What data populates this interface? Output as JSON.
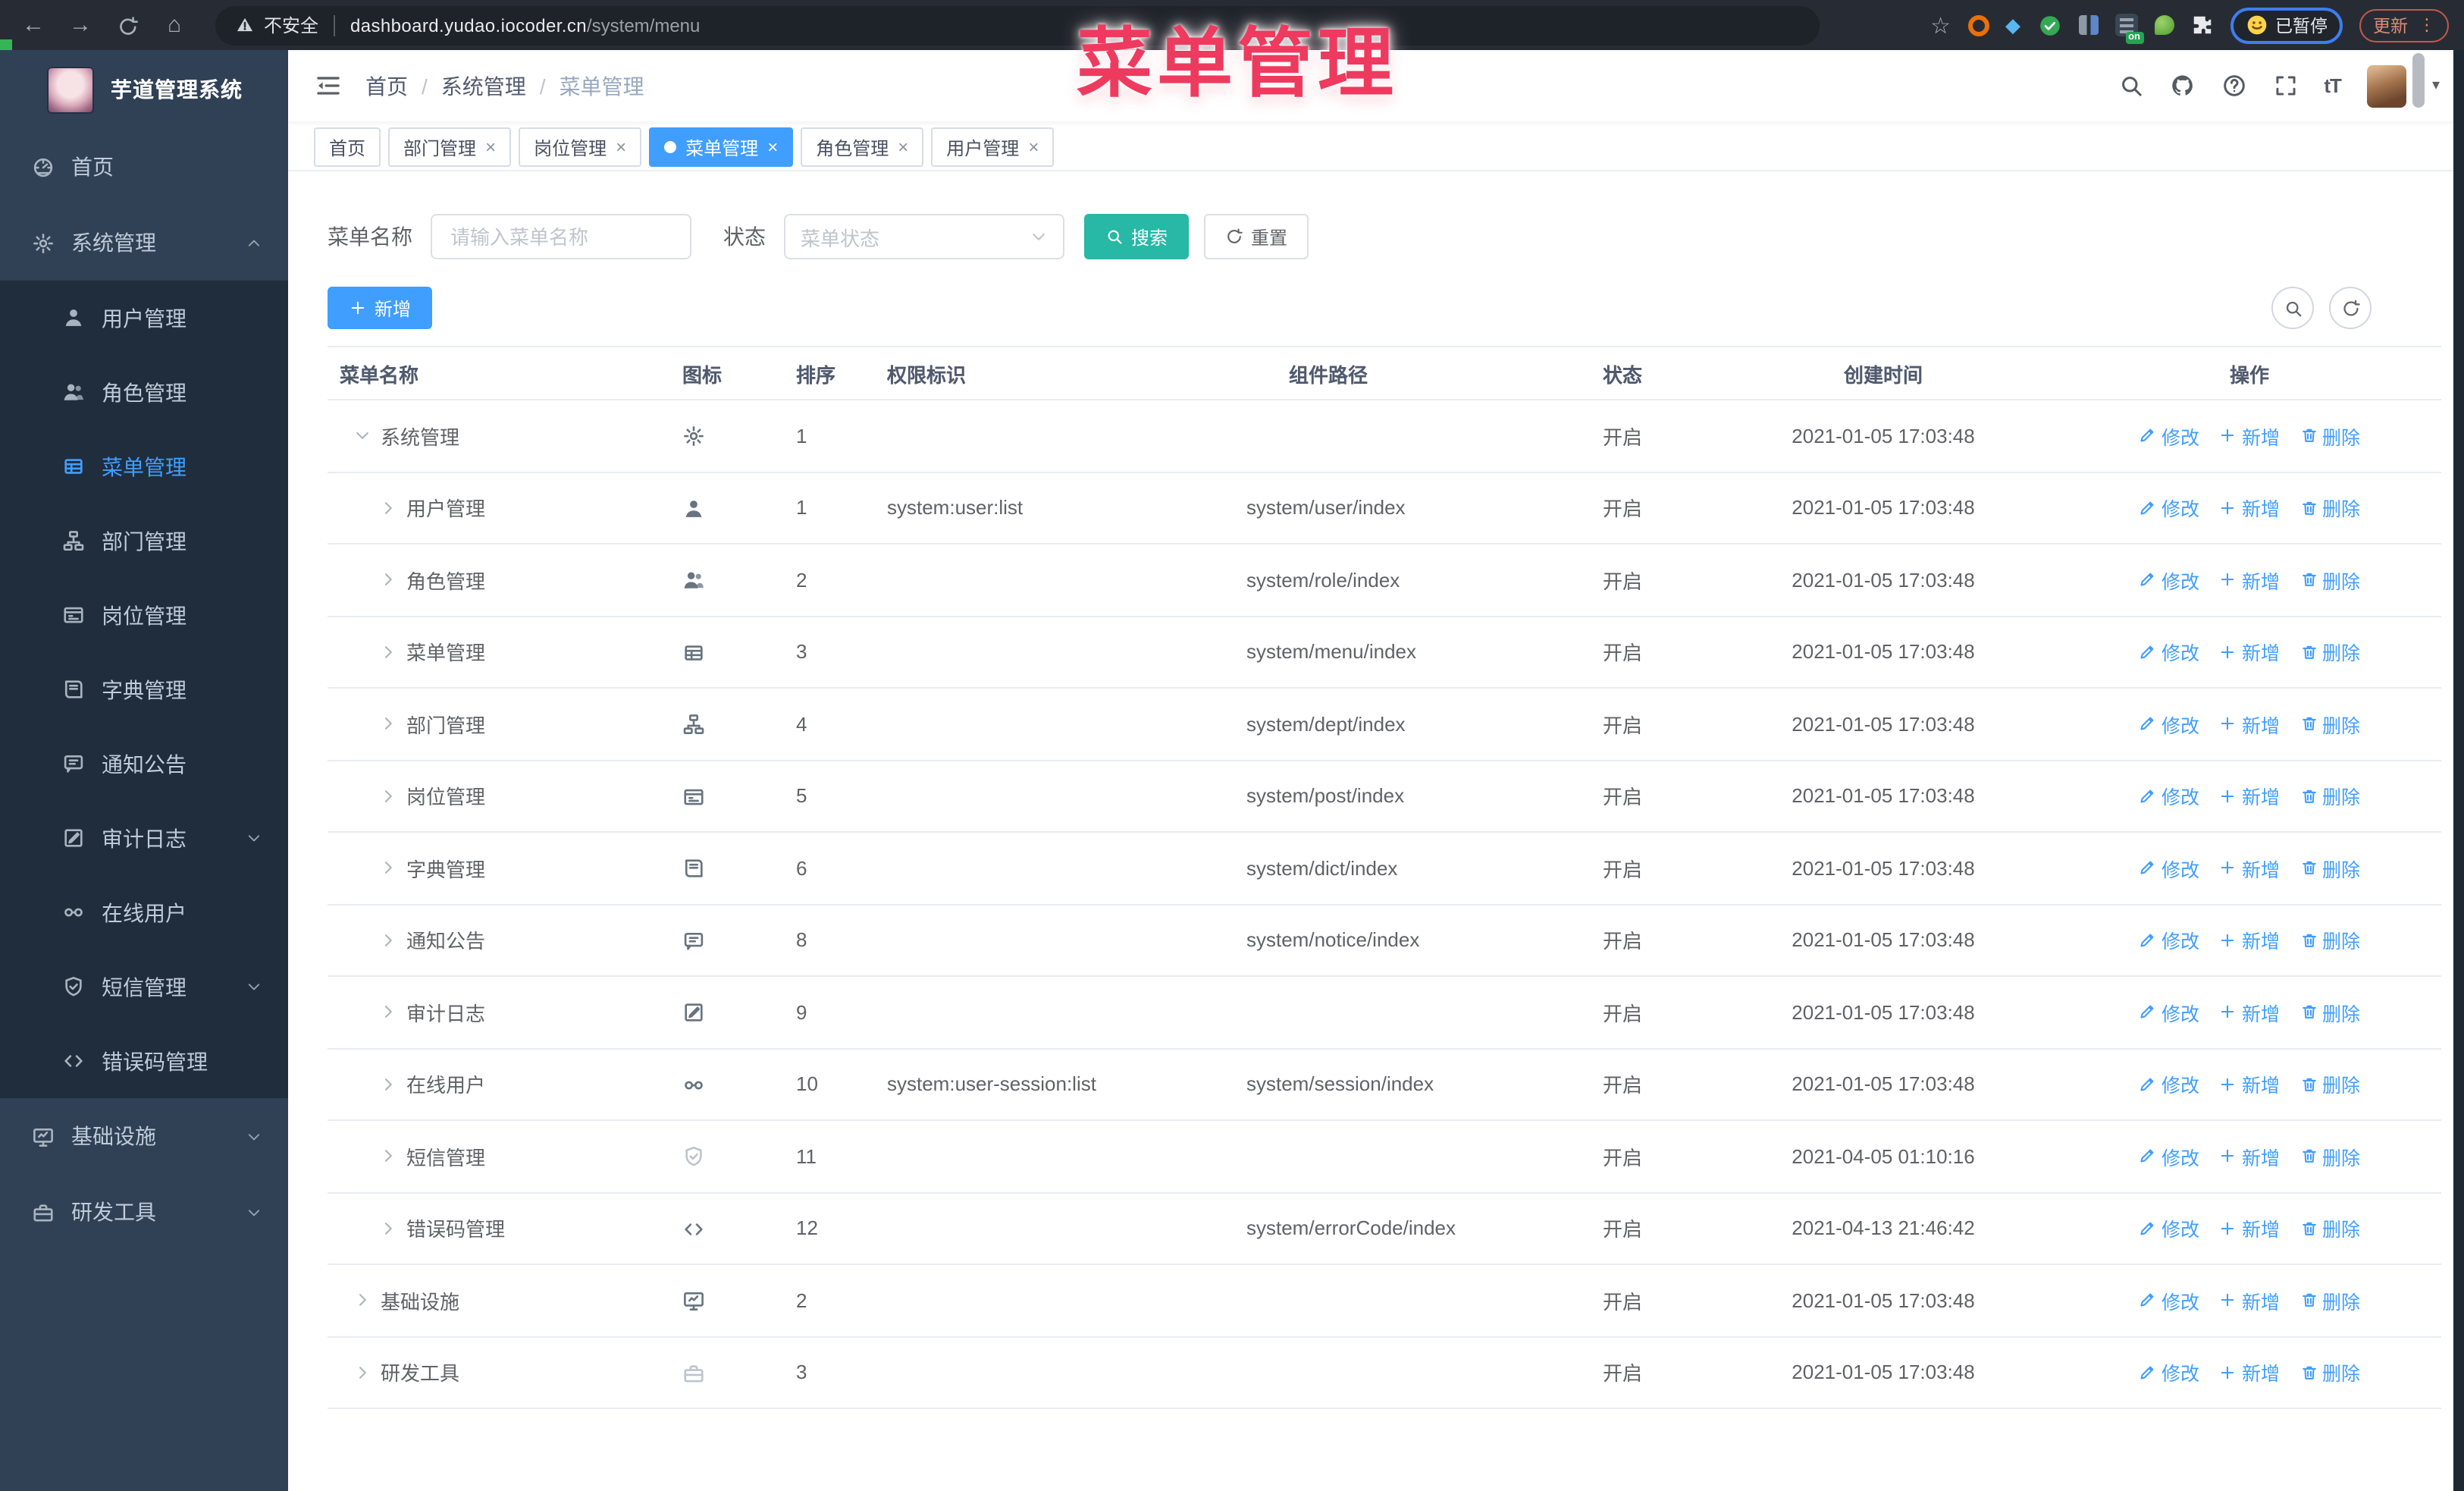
{
  "browser": {
    "security_label": "不安全",
    "url_host": "dashboard.yudao.iocoder.cn",
    "url_path": "/system/menu",
    "ext_on_label": "on",
    "paused_label": "已暂停",
    "update_label": "更新"
  },
  "overlay_title": "菜单管理",
  "icons": {
    "back": "←",
    "forward": "→",
    "home": "⌂",
    "star": "☆",
    "gem": "◆",
    "caret_down": "▾",
    "kebab": "⋮",
    "close": "×",
    "plus": "+"
  },
  "sidebar": {
    "app_title": "芋道管理系统",
    "items": [
      {
        "label": "首页",
        "icon": "dashboard-icon",
        "level": 0
      },
      {
        "label": "系统管理",
        "icon": "gear-icon",
        "level": 0,
        "arrow": "up"
      },
      {
        "label": "用户管理",
        "icon": "user-icon",
        "level": 1
      },
      {
        "label": "角色管理",
        "icon": "users-icon",
        "level": 1
      },
      {
        "label": "菜单管理",
        "icon": "menu-table-icon",
        "level": 1,
        "active": true
      },
      {
        "label": "部门管理",
        "icon": "tree-icon",
        "level": 1
      },
      {
        "label": "岗位管理",
        "icon": "idcard-icon",
        "level": 1
      },
      {
        "label": "字典管理",
        "icon": "book-icon",
        "level": 1
      },
      {
        "label": "通知公告",
        "icon": "message-icon",
        "level": 1
      },
      {
        "label": "审计日志",
        "icon": "editlog-icon",
        "level": 1,
        "arrow": "down"
      },
      {
        "label": "在线用户",
        "icon": "link-icon",
        "level": 1
      },
      {
        "label": "短信管理",
        "icon": "shield-icon",
        "level": 1,
        "arrow": "down"
      },
      {
        "label": "错误码管理",
        "icon": "code-icon",
        "level": 1
      },
      {
        "label": "基础设施",
        "icon": "monitor-icon",
        "level": 0,
        "arrow": "down"
      },
      {
        "label": "研发工具",
        "icon": "toolbox-icon",
        "level": 0,
        "arrow": "down"
      }
    ]
  },
  "header": {
    "breadcrumb": [
      "首页",
      "系统管理",
      "菜单管理"
    ],
    "icons": [
      "search-icon",
      "github-icon",
      "question-icon",
      "fullscreen-icon",
      "fontsize-icon"
    ],
    "fontsize_label": "tT"
  },
  "tabs": [
    {
      "label": "首页"
    },
    {
      "label": "部门管理",
      "closable": true
    },
    {
      "label": "岗位管理",
      "closable": true
    },
    {
      "label": "菜单管理",
      "closable": true,
      "active": true
    },
    {
      "label": "角色管理",
      "closable": true
    },
    {
      "label": "用户管理",
      "closable": true
    }
  ],
  "filters": {
    "name_label": "菜单名称",
    "name_placeholder": "请输入菜单名称",
    "status_label": "状态",
    "status_placeholder": "菜单状态",
    "search_label": "搜索",
    "reset_label": "重置"
  },
  "toolbar": {
    "add_label": "新增"
  },
  "table": {
    "columns": [
      "菜单名称",
      "图标",
      "排序",
      "权限标识",
      "组件路径",
      "状态",
      "创建时间",
      "操作"
    ],
    "actions": [
      {
        "label": "修改",
        "icon": "pencil-icon",
        "name": "edit-link"
      },
      {
        "label": "新增",
        "icon": "plus-icon",
        "name": "add-inline-link"
      },
      {
        "label": "删除",
        "icon": "trash-icon",
        "name": "delete-link"
      }
    ],
    "rows": [
      {
        "name": "系统管理",
        "level": 0,
        "caret": "down",
        "icon": "gear-icon",
        "sort": "1",
        "perm": "",
        "path": "",
        "status": "开启",
        "created": "2021-01-05 17:03:48"
      },
      {
        "name": "用户管理",
        "level": 1,
        "caret": "right",
        "icon": "user-icon",
        "sort": "1",
        "perm": "system:user:list",
        "path": "system/user/index",
        "status": "开启",
        "created": "2021-01-05 17:03:48"
      },
      {
        "name": "角色管理",
        "level": 1,
        "caret": "right",
        "icon": "users-icon",
        "sort": "2",
        "perm": "",
        "path": "system/role/index",
        "status": "开启",
        "created": "2021-01-05 17:03:48"
      },
      {
        "name": "菜单管理",
        "level": 1,
        "caret": "right",
        "icon": "menu-table-icon",
        "sort": "3",
        "perm": "",
        "path": "system/menu/index",
        "status": "开启",
        "created": "2021-01-05 17:03:48"
      },
      {
        "name": "部门管理",
        "level": 1,
        "caret": "right",
        "icon": "tree-icon",
        "sort": "4",
        "perm": "",
        "path": "system/dept/index",
        "status": "开启",
        "created": "2021-01-05 17:03:48"
      },
      {
        "name": "岗位管理",
        "level": 1,
        "caret": "right",
        "icon": "idcard-icon",
        "sort": "5",
        "perm": "",
        "path": "system/post/index",
        "status": "开启",
        "created": "2021-01-05 17:03:48"
      },
      {
        "name": "字典管理",
        "level": 1,
        "caret": "right",
        "icon": "book-icon",
        "sort": "6",
        "perm": "",
        "path": "system/dict/index",
        "status": "开启",
        "created": "2021-01-05 17:03:48"
      },
      {
        "name": "通知公告",
        "level": 1,
        "caret": "right",
        "icon": "message-icon",
        "sort": "8",
        "perm": "",
        "path": "system/notice/index",
        "status": "开启",
        "created": "2021-01-05 17:03:48"
      },
      {
        "name": "审计日志",
        "level": 1,
        "caret": "right",
        "icon": "editlog-icon",
        "sort": "9",
        "perm": "",
        "path": "",
        "status": "开启",
        "created": "2021-01-05 17:03:48"
      },
      {
        "name": "在线用户",
        "level": 1,
        "caret": "right",
        "icon": "link-icon",
        "sort": "10",
        "perm": "system:user-session:list",
        "path": "system/session/index",
        "status": "开启",
        "created": "2021-01-05 17:03:48"
      },
      {
        "name": "短信管理",
        "level": 1,
        "caret": "right",
        "icon": "shield-icon",
        "icon_light": true,
        "sort": "11",
        "perm": "",
        "path": "",
        "status": "开启",
        "created": "2021-04-05 01:10:16"
      },
      {
        "name": "错误码管理",
        "level": 1,
        "caret": "right",
        "icon": "code-icon",
        "sort": "12",
        "perm": "",
        "path": "system/errorCode/index",
        "status": "开启",
        "created": "2021-04-13 21:46:42"
      },
      {
        "name": "基础设施",
        "level": 0,
        "caret": "right",
        "icon": "monitor-icon",
        "sort": "2",
        "perm": "",
        "path": "",
        "status": "开启",
        "created": "2021-01-05 17:03:48"
      },
      {
        "name": "研发工具",
        "level": 0,
        "caret": "right",
        "icon": "toolbox-icon",
        "icon_light": true,
        "sort": "3",
        "perm": "",
        "path": "",
        "status": "开启",
        "created": "2021-01-05 17:03:48"
      }
    ]
  },
  "colors": {
    "accent": "#409eff",
    "search_button": "#27b8a6",
    "sidebar_bg": "#304156",
    "submenu_bg": "#1f2d3d",
    "annotation": "#ee3a5e"
  }
}
